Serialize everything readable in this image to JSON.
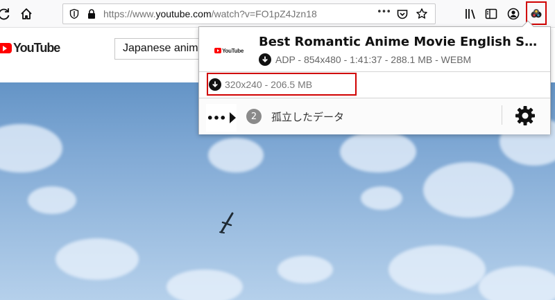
{
  "browser": {
    "url_prefix": "https://www.",
    "url_host": "youtube.com",
    "url_path": "/watch?v=FO1pZ4Jzn18",
    "page_actions": "•••"
  },
  "youtube": {
    "logo_text": "YouTube",
    "search_value": "Japanese animation"
  },
  "popup": {
    "thumb_logo_text": "YouTube",
    "video_title": "Best Romantic Anime Movie English Subbed...",
    "main_download": "ADP - 854x480 - 1:41:37 - 288.1 MB - WEBM",
    "alt_download": "320x240 - 206.5 MB",
    "more_dots": "•••",
    "orphan_count": "2",
    "orphan_label": "孤立したデータ"
  },
  "colors": {
    "highlight": "#d00000",
    "youtube_red": "#ff0000"
  }
}
